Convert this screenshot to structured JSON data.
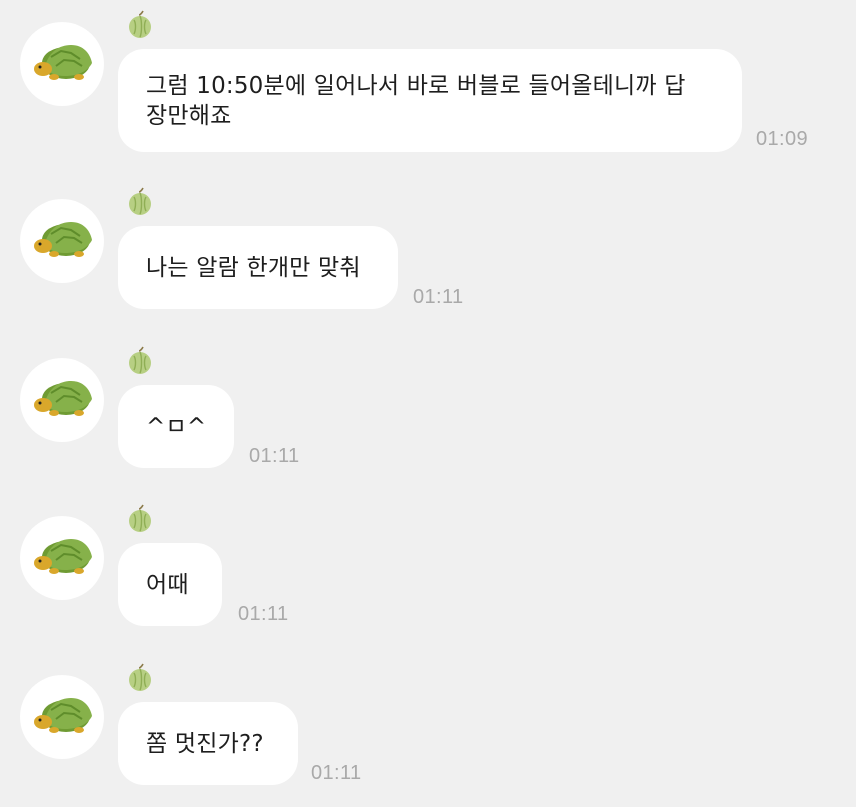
{
  "messages": [
    {
      "text": "그럼 10:50분에 일어나서 바로 버블로 들어올테니까 답\n장만해죠",
      "time": "01:09"
    },
    {
      "text": "나는 알람 한개만 맞춰",
      "time": "01:11"
    },
    {
      "text": "^ㅁ^",
      "time": "01:11"
    },
    {
      "text": "어때",
      "time": "01:11"
    },
    {
      "text": "쫌 멋진가??",
      "time": "01:11"
    }
  ],
  "icons": {
    "avatar": "turtle-avatar-icon",
    "name_badge": "melon-icon"
  },
  "colors": {
    "background": "#f0f0f0",
    "bubble": "#ffffff",
    "text": "#1e1e1e",
    "timestamp": "#a9a9a9",
    "turtle_shell": "#7ea83c",
    "turtle_skin": "#d9a72b",
    "melon": "#b7cf83"
  }
}
